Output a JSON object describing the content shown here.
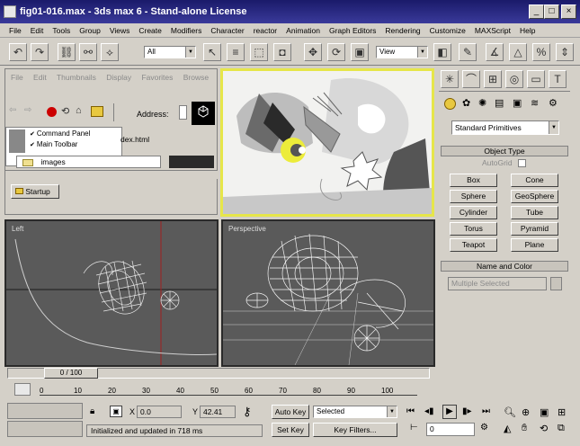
{
  "window": {
    "title": "fig01-016.max - 3ds max 6 - Stand-alone License"
  },
  "menubar": {
    "items": [
      "File",
      "Edit",
      "Tools",
      "Group",
      "Views",
      "Create",
      "Modifiers",
      "Character",
      "reactor",
      "Animation",
      "Graph Editors",
      "Rendering",
      "Customize",
      "MAXScript",
      "Help"
    ]
  },
  "toolbar": {
    "selection_filter": "All",
    "ref_coord": "View"
  },
  "browser": {
    "menu": "File Edit Thumbnails Display Favorites Browse",
    "address_label": "Address:",
    "checks": [
      "Command Panel",
      "Main Toolbar"
    ],
    "file": "dex.html",
    "tree_item": "images",
    "tab": "Startup"
  },
  "viewports": {
    "left_label": "Left",
    "persp_label": "Perspective"
  },
  "cmd": {
    "category": "Standard Primitives",
    "object_type_title": "Object Type",
    "autogrid": "AutoGrid",
    "buttons": [
      "Box",
      "Cone",
      "Sphere",
      "GeoSphere",
      "Cylinder",
      "Tube",
      "Torus",
      "Pyramid",
      "Teapot",
      "Plane"
    ],
    "name_color_title": "Name and Color",
    "name_value": "Multiple Selected"
  },
  "timeline": {
    "slider": "0 / 100",
    "ticks": [
      "0",
      "10",
      "20",
      "30",
      "40",
      "50",
      "60",
      "70",
      "80",
      "90",
      "100"
    ]
  },
  "status": {
    "message": "Initialized and updated in 718 ms",
    "x_label": "X",
    "x_value": "0.0",
    "y_label": "Y",
    "y_value": "42.41",
    "auto_key": "Auto Key",
    "set_key": "Set Key",
    "selected": "Selected",
    "key_filters": "Key Filters...",
    "frame": "0"
  },
  "colors": {
    "title_bar": "#1a1a6a",
    "active_viewport": "#e6e64a",
    "viewport_bg": "#5a5a5a"
  }
}
